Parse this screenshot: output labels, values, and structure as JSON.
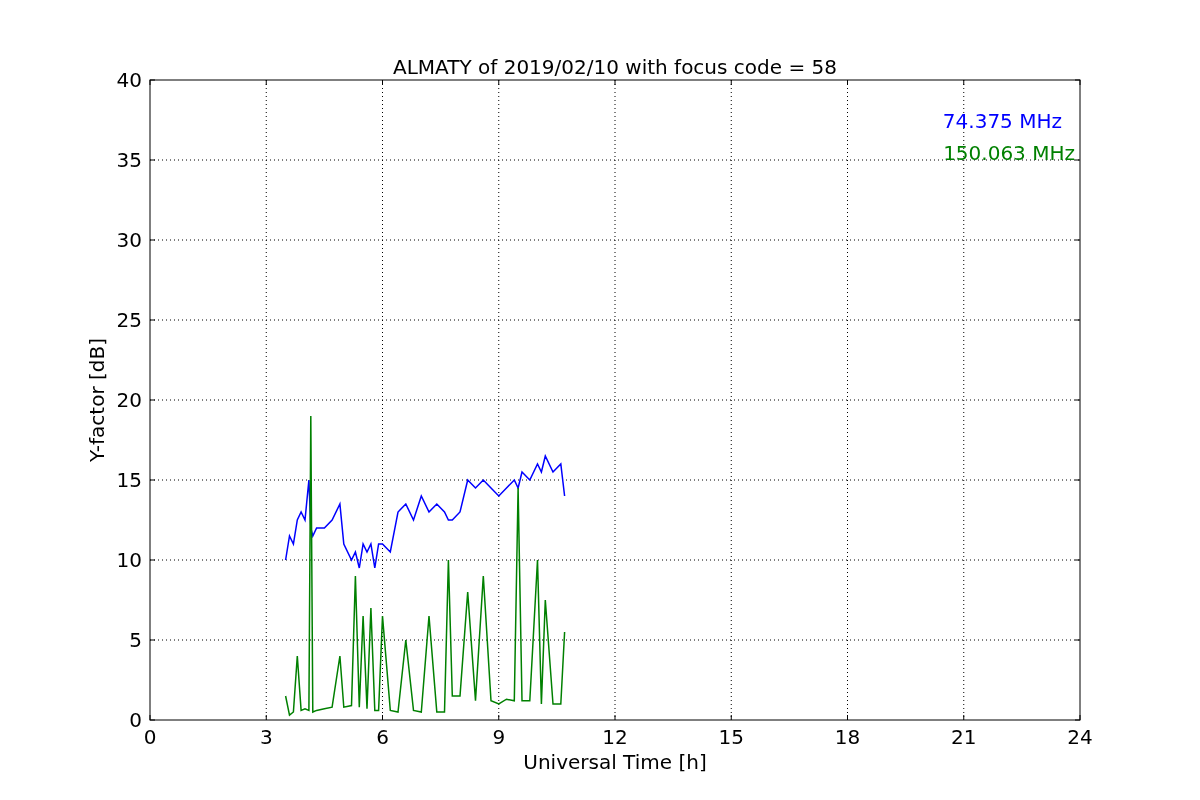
{
  "chart_data": {
    "type": "line",
    "title": "ALMATY of 2019/02/10 with focus code = 58",
    "xlabel": "Universal Time [h]",
    "ylabel": "Y-factor [dB]",
    "x": [
      3.5,
      3.6,
      3.7,
      3.8,
      3.9,
      4.0,
      4.1,
      4.15,
      4.2,
      4.3,
      4.5,
      4.7,
      4.9,
      5.0,
      5.2,
      5.3,
      5.4,
      5.5,
      5.6,
      5.7,
      5.8,
      5.9,
      6.0,
      6.2,
      6.4,
      6.6,
      6.8,
      7.0,
      7.2,
      7.4,
      7.6,
      7.7,
      7.8,
      8.0,
      8.2,
      8.4,
      8.6,
      8.8,
      9.0,
      9.2,
      9.4,
      9.5,
      9.6,
      9.8,
      10.0,
      10.1,
      10.2,
      10.4,
      10.6,
      10.7
    ],
    "series": [
      {
        "name": "74.375 MHz",
        "color": "#0000ff",
        "values": [
          10,
          11.5,
          11,
          12.5,
          13,
          12.5,
          15,
          12,
          11.5,
          12,
          12,
          12.5,
          13.5,
          11,
          10,
          10.5,
          9.5,
          11,
          10.5,
          11,
          9.5,
          11,
          11,
          10.5,
          13,
          13.5,
          12.5,
          14,
          13,
          13.5,
          13,
          12.5,
          12.5,
          13,
          15,
          14.5,
          15,
          14.5,
          14,
          14.5,
          15,
          14.5,
          15.5,
          15,
          16,
          15.5,
          16.5,
          15.5,
          16,
          14
        ]
      },
      {
        "name": "150.063 MHz",
        "color": "#008000",
        "values": [
          1.5,
          0.3,
          0.5,
          4,
          0.6,
          0.7,
          0.6,
          19,
          0.5,
          0.6,
          0.7,
          0.8,
          4,
          0.8,
          0.9,
          9,
          0.8,
          6.5,
          0.7,
          7,
          0.6,
          0.6,
          6.5,
          0.6,
          0.5,
          5,
          0.6,
          0.5,
          6.5,
          0.5,
          0.5,
          10,
          1.5,
          1.5,
          8,
          1.2,
          9,
          1.2,
          1,
          1.3,
          1.2,
          14.5,
          1.2,
          1.2,
          10,
          1,
          7.5,
          1,
          1,
          5.5
        ]
      }
    ],
    "grid": true,
    "xlim": [
      0,
      24
    ],
    "ylim": [
      0,
      40
    ],
    "xticks": [
      0,
      3,
      6,
      9,
      12,
      15,
      18,
      21,
      24
    ],
    "yticks": [
      0,
      5,
      10,
      15,
      20,
      25,
      30,
      35,
      40
    ]
  }
}
